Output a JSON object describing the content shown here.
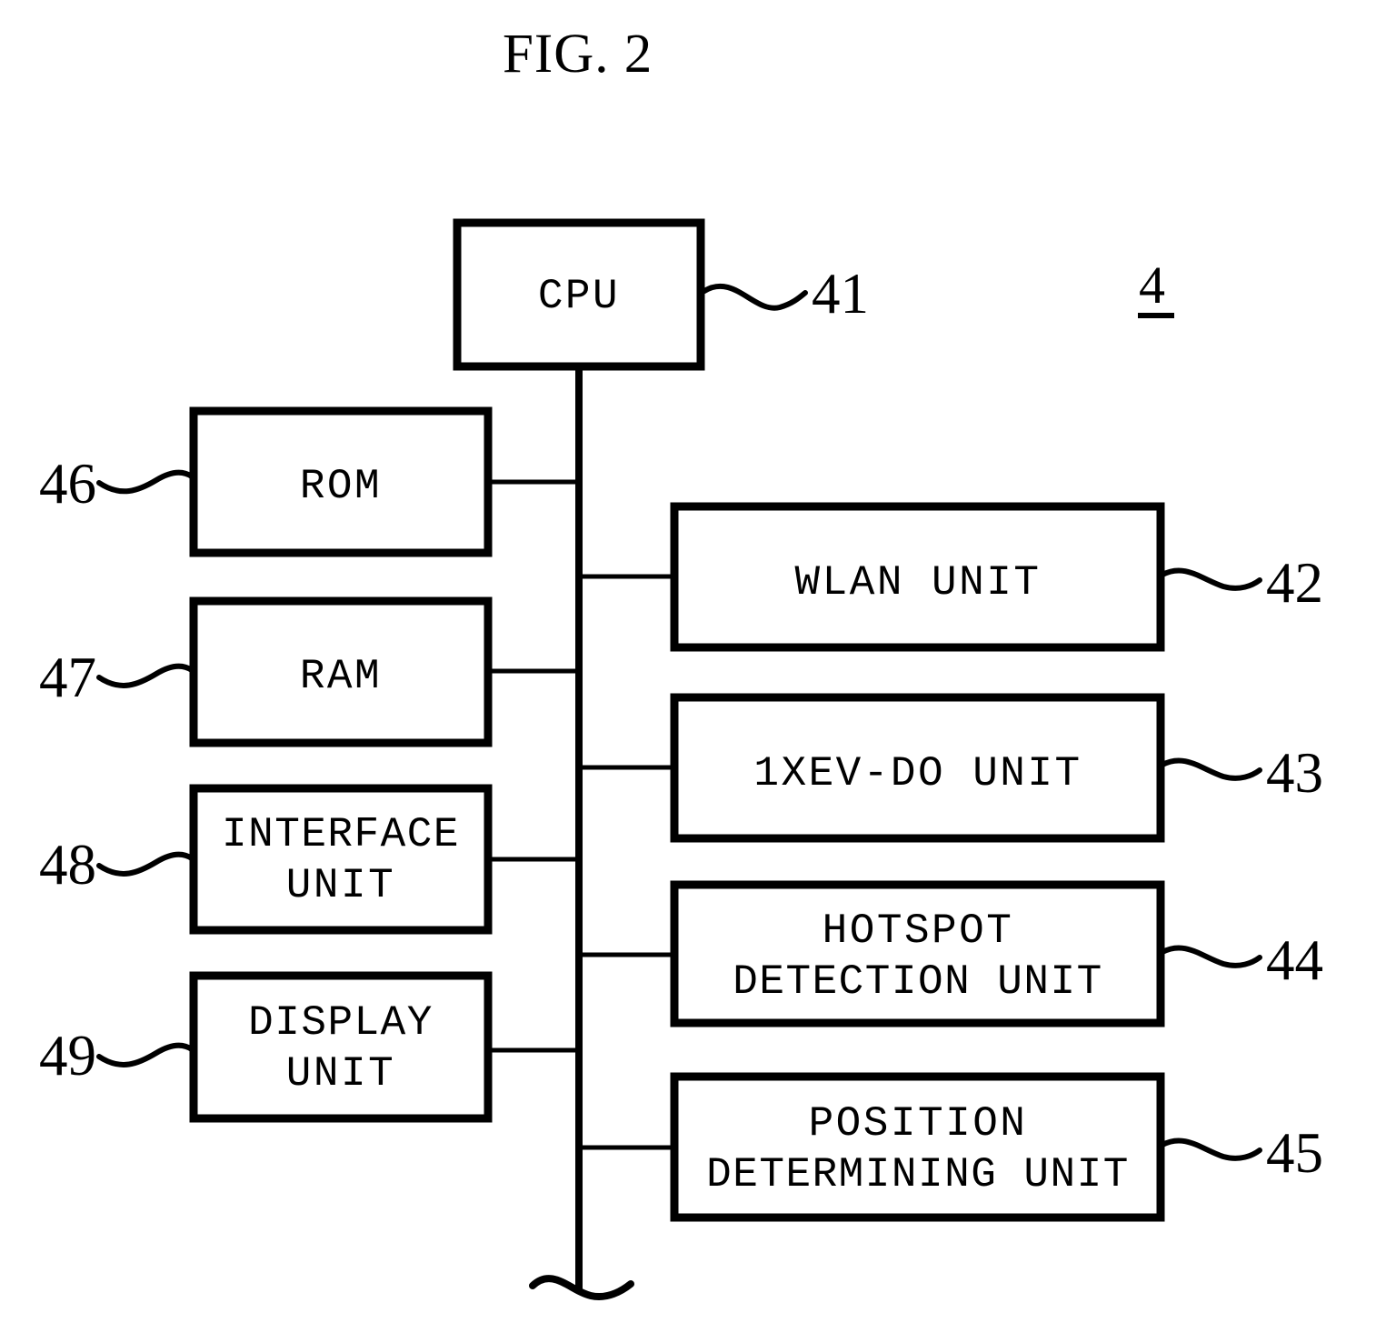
{
  "figure": {
    "title": "FIG. 2",
    "figure_id": "4",
    "type": "block-diagram"
  },
  "blocks": {
    "cpu": {
      "label": "CPU",
      "ref": "41"
    },
    "rom": {
      "label": "ROM",
      "ref": "46"
    },
    "ram": {
      "label": "RAM",
      "ref": "47"
    },
    "interface": {
      "label_line1": "INTERFACE",
      "label_line2": "UNIT",
      "ref": "48"
    },
    "display": {
      "label_line1": "DISPLAY",
      "label_line2": "UNIT",
      "ref": "49"
    },
    "wlan": {
      "label": "WLAN UNIT",
      "ref": "42"
    },
    "evdo": {
      "label": "1XEV-DO UNIT",
      "ref": "43"
    },
    "hotspot": {
      "label_line1": "HOTSPOT",
      "label_line2": "DETECTION UNIT",
      "ref": "44"
    },
    "position": {
      "label_line1": "POSITION",
      "label_line2": "DETERMINING UNIT",
      "ref": "45"
    }
  },
  "colors": {
    "ink": "#000000",
    "paper": "#ffffff"
  }
}
